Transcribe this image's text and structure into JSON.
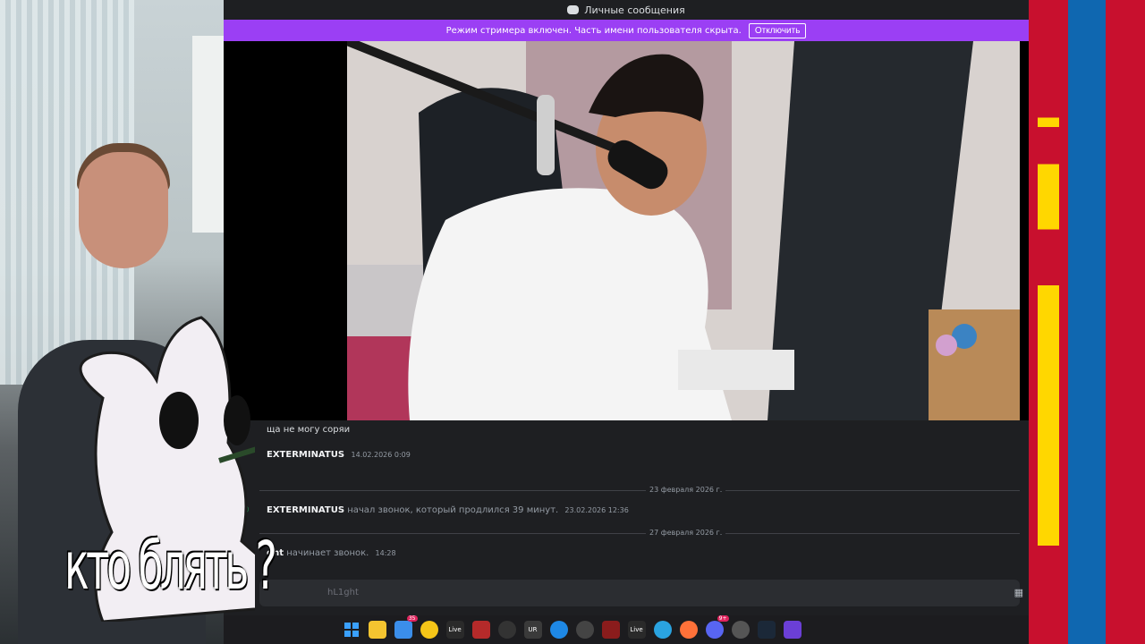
{
  "window": {
    "title": "Личные сообщения"
  },
  "streamer_mode": {
    "text": "Режим стримера включен. Часть имени пользователя скрыта.",
    "button": "Отключить"
  },
  "overlay": {
    "caption": "кто блять ?"
  },
  "messages": [
    {
      "type": "text",
      "text": "ща не могу соряи"
    },
    {
      "type": "message",
      "author": "EXTERMINATUS",
      "timestamp": "14.02.2026 0:09"
    }
  ],
  "dates": [
    "23 февраля 2026 г.",
    "27 февраля 2026 г."
  ],
  "calls": [
    {
      "author": "EXTERMINATUS",
      "text": "начал звонок, который продлился 39 минут.",
      "timestamp": "23.02.2026 12:36"
    },
    {
      "author": "ght",
      "text": "начинает звонок.",
      "timestamp": "14:28"
    }
  ],
  "input": {
    "placeholder_fragment": "hL1ght"
  },
  "taskbar": {
    "icons": [
      "windows-icon",
      "explorer-icon",
      "vscode-badge-icon",
      "app-yellow-icon",
      "live-icon",
      "app-red-icon",
      "app-circle-icon",
      "app-grid-icon",
      "app-blue-icon",
      "app-github-icon",
      "app-valorant-icon",
      "live-icon-2",
      "telegram-icon",
      "firefox-icon",
      "discord-icon",
      "settings-icon",
      "steam-icon",
      "app-purple-icon"
    ],
    "badges": {
      "vscode": "35",
      "discord": "9+"
    },
    "labels": {
      "live": "Live",
      "live2": "Live",
      "grid": "UR"
    }
  },
  "colors": {
    "discord_bg": "#1e1f22",
    "streamer_bar": "#9b3ff4",
    "call_icon": "#23a55a",
    "flag_red": "#c8102e",
    "flag_blue": "#0f67b0",
    "soyombo": "#ffd700"
  }
}
